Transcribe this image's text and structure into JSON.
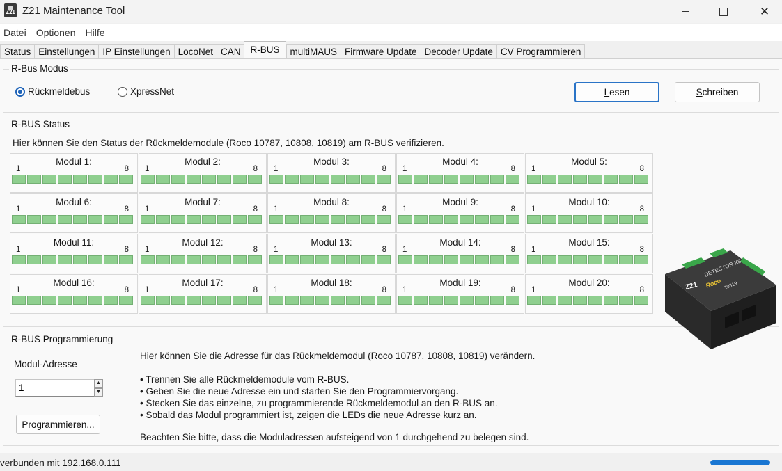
{
  "window": {
    "title": "Z21 Maintenance Tool",
    "icon": "z21-app-icon"
  },
  "menu": [
    "Datei",
    "Optionen",
    "Hilfe"
  ],
  "tabs": [
    "Status",
    "Einstellungen",
    "IP Einstellungen",
    "LocoNet",
    "CAN",
    "R-BUS",
    "multiMAUS",
    "Firmware Update",
    "Decoder Update",
    "CV Programmieren"
  ],
  "active_tab": "R-BUS",
  "modus": {
    "legend": "R-Bus Modus",
    "options": [
      {
        "label": "Rückmeldebus",
        "selected": true
      },
      {
        "label": "XpressNet",
        "selected": false
      }
    ],
    "read_label": "Lesen",
    "write_label": "Schreiben"
  },
  "status": {
    "legend": "R-BUS Status",
    "intro": "Hier können Sie den Status der Rückmeldemodule (Roco 10787, 10808, 10819) am R-BUS verifizieren.",
    "index_first": "1",
    "index_last": "8",
    "led_color": "#8fcf8f",
    "modules": [
      {
        "name": "Modul 1:"
      },
      {
        "name": "Modul 2:"
      },
      {
        "name": "Modul 3:"
      },
      {
        "name": "Modul 4:"
      },
      {
        "name": "Modul 5:"
      },
      {
        "name": "Modul 6:"
      },
      {
        "name": "Modul 7:"
      },
      {
        "name": "Modul 8:"
      },
      {
        "name": "Modul 9:"
      },
      {
        "name": "Modul 10:"
      },
      {
        "name": "Modul 11:"
      },
      {
        "name": "Modul 12:"
      },
      {
        "name": "Modul 13:"
      },
      {
        "name": "Modul 14:"
      },
      {
        "name": "Modul 15:"
      },
      {
        "name": "Modul 16:"
      },
      {
        "name": "Modul 17:"
      },
      {
        "name": "Modul 18:"
      },
      {
        "name": "Modul 19:"
      },
      {
        "name": "Modul 20:"
      }
    ]
  },
  "device_image": {
    "brand": "Z21",
    "model_label": "DETECTOR X8",
    "maker": "Roco",
    "number": "10819"
  },
  "programming": {
    "legend": "R-BUS Programmierung",
    "address_label": "Modul-Adresse",
    "address_value": "1",
    "program_button": "Programmieren...",
    "intro": "Hier können Sie die Adresse für das Rückmeldemodul (Roco 10787, 10808, 10819) verändern.",
    "steps": [
      "• Trennen Sie alle Rückmeldemodule vom R-BUS.",
      "• Geben Sie die neue Adresse ein und starten Sie den Programmiervorgang.",
      "• Stecken Sie das einzelne, zu programmierende Rückmeldemodul an den R-BUS an.",
      "• Sobald das Modul programmiert ist, zeigen die LEDs die neue Adresse kurz an."
    ],
    "note": "Beachten Sie bitte, dass die Moduladressen aufsteigend von 1 durchgehend zu belegen sind."
  },
  "statusbar": {
    "connection": "verbunden mit 192.168.0.111",
    "progress": 1.0,
    "progress_color": "#1976d2"
  }
}
